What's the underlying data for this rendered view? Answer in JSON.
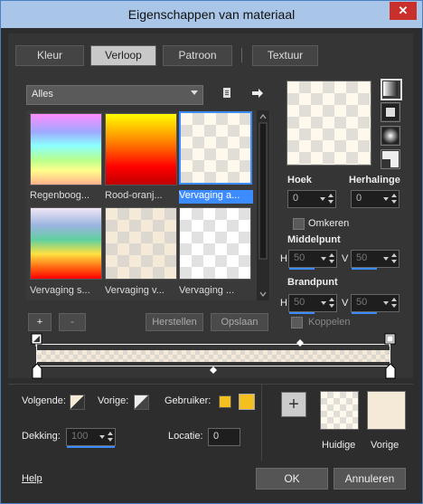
{
  "window": {
    "title": "Eigenschappen van materiaal",
    "close": "✕"
  },
  "tabs": [
    {
      "label": "Kleur"
    },
    {
      "label": "Verloop"
    },
    {
      "label": "Patroon"
    },
    {
      "label": "Textuur"
    }
  ],
  "category": {
    "value": "Alles"
  },
  "gallery": {
    "items": [
      {
        "label": "Regenboog..."
      },
      {
        "label": "Rood-oranj..."
      },
      {
        "label": "Vervaging a..."
      },
      {
        "label": "Vervaging s..."
      },
      {
        "label": "Vervaging v..."
      },
      {
        "label": "Vervaging ..."
      }
    ]
  },
  "gallery_buttons": {
    "add": "+",
    "remove": "-",
    "restore": "Herstellen",
    "save": "Opslaan"
  },
  "settings": {
    "angle_label": "Hoek",
    "angle_value": "0",
    "repeat_label": "Herhalinge",
    "repeat_value": "0",
    "invert_label": "Omkeren",
    "midpoint_label": "Middelpunt",
    "midpoint_h_label": "H",
    "midpoint_h": "50",
    "midpoint_v_label": "V",
    "midpoint_v": "50",
    "focal_label": "Brandpunt",
    "focal_h_label": "H",
    "focal_h": "50",
    "focal_v_label": "V",
    "focal_v": "50",
    "link_label": "Koppelen"
  },
  "bottom": {
    "next_label": "Volgende:",
    "prev_label": "Vorige:",
    "user_label": "Gebruiker:",
    "opacity_label": "Dekking:",
    "opacity_value": "100",
    "location_label": "Locatie:",
    "location_value": "0",
    "current_label": "Huidige",
    "previous_label": "Vorige",
    "add": "+"
  },
  "footer": {
    "help": "Help",
    "ok": "OK",
    "cancel": "Annuleren"
  },
  "colors": {
    "accent": "#3c8cff",
    "user_swatch": "#f4c020",
    "cream": "#f5ead8"
  }
}
